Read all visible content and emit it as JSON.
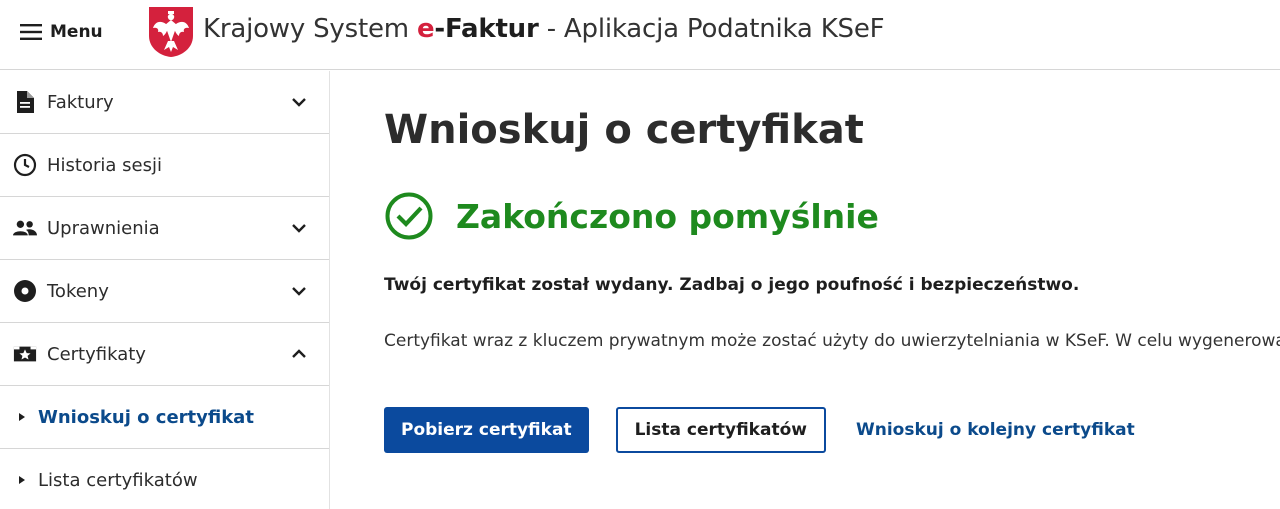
{
  "header": {
    "menu_label": "Menu",
    "title_prefix": "Krajowy System ",
    "title_e": "e",
    "title_faktur": "-Faktur",
    "title_suffix": " - Aplikacja Podatnika KSeF",
    "emblem_color": "#d4213d"
  },
  "sidebar": {
    "items": [
      {
        "label": "Faktury",
        "icon": "document-icon",
        "expanded": false
      },
      {
        "label": "Historia sesji",
        "icon": "clock-icon"
      },
      {
        "label": "Uprawnienia",
        "icon": "users-icon",
        "expanded": false
      },
      {
        "label": "Tokeny",
        "icon": "token-icon",
        "expanded": false
      },
      {
        "label": "Certyfikaty",
        "icon": "certificate-icon",
        "expanded": true
      }
    ],
    "subitems": [
      {
        "label": "Wnioskuj o certyfikat",
        "active": true
      },
      {
        "label": "Lista certyfikatów",
        "active": false
      }
    ]
  },
  "main": {
    "page_title": "Wnioskuj o certyfikat",
    "status_text": "Zakończono pomyślnie",
    "lead_text": "Twój certyfikat został wydany. Zadbaj o jego poufność i bezpieczeństwo.",
    "description": "Certyfikat wraz z kluczem prywatnym może zostać użyty do uwierzytelniania w KSeF. W celu wygenerowania",
    "buttons": {
      "download": "Pobierz certyfikat",
      "list": "Lista certyfikatów",
      "request_another": "Wnioskuj o kolejny certyfikat"
    }
  },
  "colors": {
    "primary": "#0b4a9e",
    "success": "#1e8a1e",
    "brand_red": "#d4213d"
  }
}
